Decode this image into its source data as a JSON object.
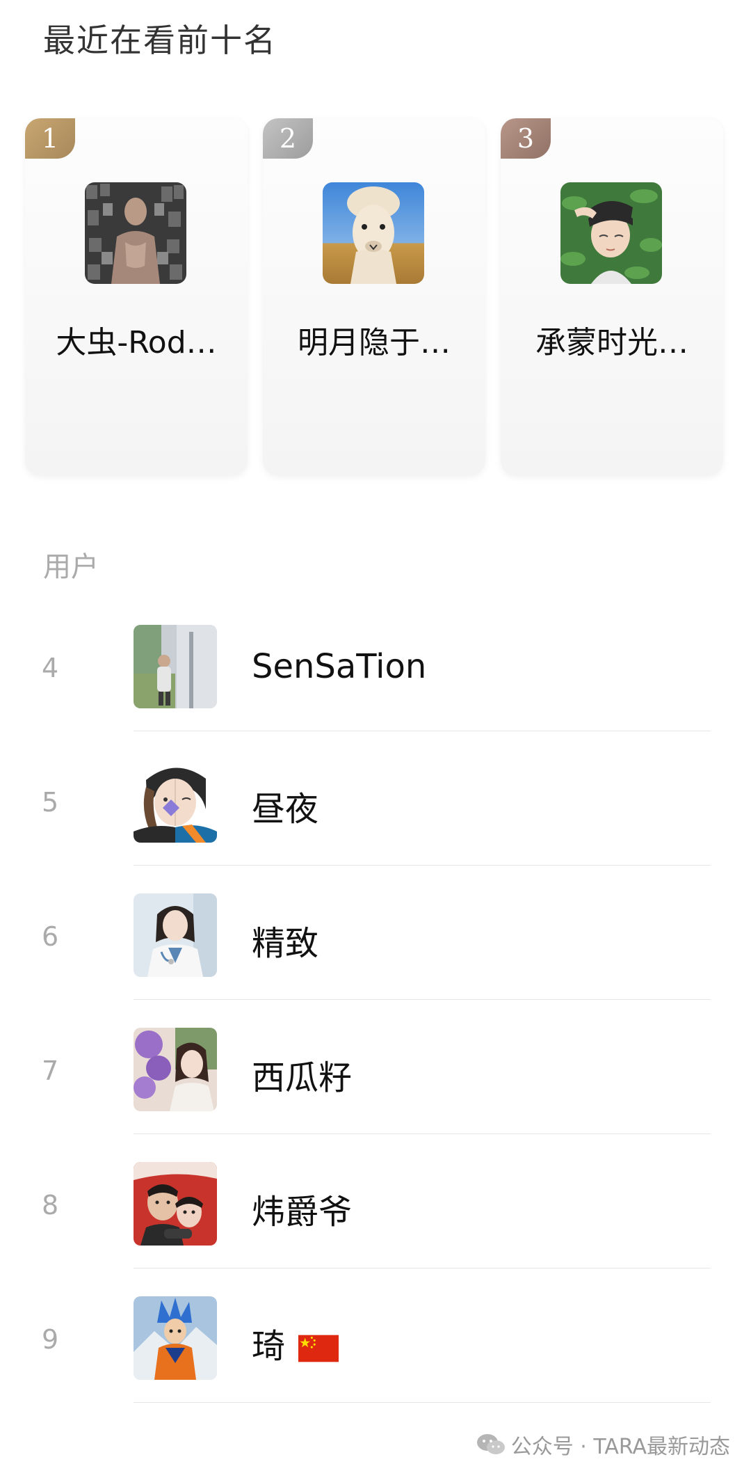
{
  "header": {
    "title": "最近在看前十名"
  },
  "top_cards": [
    {
      "rank": "1",
      "name": "大虫-Rod…",
      "avatar_icon": "muscle-man-collage-avatar"
    },
    {
      "rank": "2",
      "name": "明月隐于…",
      "avatar_icon": "alpaca-avatar"
    },
    {
      "rank": "3",
      "name": "承蒙时光…",
      "avatar_icon": "anime-boy-leaves-avatar"
    }
  ],
  "section": {
    "label": "用户"
  },
  "users": [
    {
      "rank": "4",
      "name": "SenSaTion",
      "avatar_icon": "outdoor-person-avatar"
    },
    {
      "rank": "5",
      "name": "昼夜",
      "avatar_icon": "split-face-anime-avatar"
    },
    {
      "rank": "6",
      "name": "精致",
      "avatar_icon": "doctor-avatar"
    },
    {
      "rank": "7",
      "name": "西瓜籽",
      "avatar_icon": "girl-balloons-avatar"
    },
    {
      "rank": "8",
      "name": "炜爵爷",
      "avatar_icon": "couple-avatar"
    },
    {
      "rank": "9",
      "name": "琦",
      "flag": "china-flag-icon",
      "avatar_icon": "goku-avatar"
    }
  ],
  "footer": {
    "text": "公众号 · TARA最新动态"
  }
}
